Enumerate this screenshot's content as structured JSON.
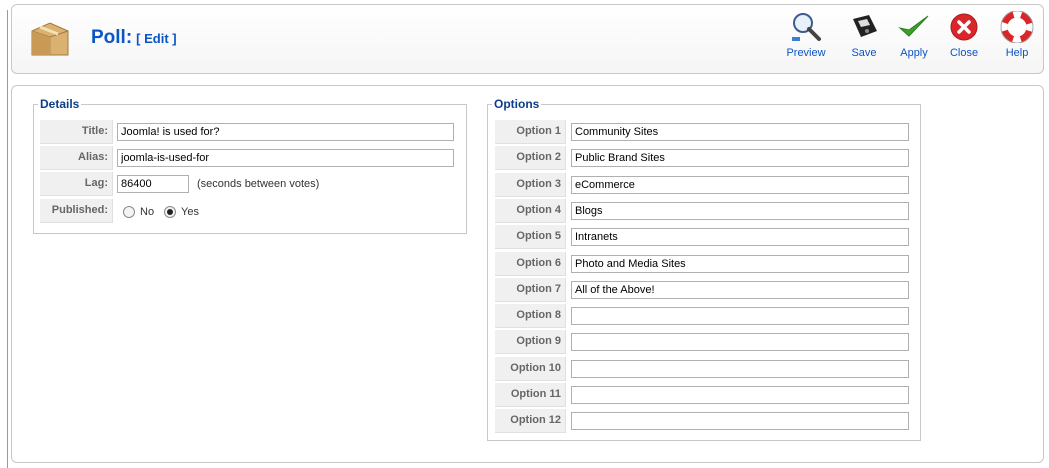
{
  "header": {
    "title": "Poll:",
    "subtitle": "[ Edit ]",
    "icon": "poll-box-icon"
  },
  "toolbar": {
    "buttons": [
      {
        "label": "Preview",
        "icon": "magnifier-icon"
      },
      {
        "label": "Save",
        "icon": "floppy-disk-icon"
      },
      {
        "label": "Apply",
        "icon": "checkmark-icon"
      },
      {
        "label": "Close",
        "icon": "close-icon"
      },
      {
        "label": "Help",
        "icon": "lifebuoy-icon"
      }
    ]
  },
  "details": {
    "legend": "Details",
    "title_label": "Title:",
    "title_value": "Joomla! is used for?",
    "alias_label": "Alias:",
    "alias_value": "joomla-is-used-for",
    "lag_label": "Lag:",
    "lag_value": "86400",
    "lag_note": "(seconds between votes)",
    "published_label": "Published:",
    "published_no": "No",
    "published_yes": "Yes",
    "published_selected": "Yes"
  },
  "options": {
    "legend": "Options",
    "items": [
      {
        "label": "Option 1",
        "value": "Community Sites"
      },
      {
        "label": "Option 2",
        "value": "Public Brand Sites"
      },
      {
        "label": "Option 3",
        "value": "eCommerce"
      },
      {
        "label": "Option 4",
        "value": "Blogs"
      },
      {
        "label": "Option 5",
        "value": "Intranets"
      },
      {
        "label": "Option 6",
        "value": "Photo and Media Sites"
      },
      {
        "label": "Option 7",
        "value": "All of the Above!"
      },
      {
        "label": "Option 8",
        "value": ""
      },
      {
        "label": "Option 9",
        "value": ""
      },
      {
        "label": "Option 10",
        "value": ""
      },
      {
        "label": "Option 11",
        "value": ""
      },
      {
        "label": "Option 12",
        "value": ""
      }
    ]
  },
  "colors": {
    "title_blue": "#0b55c4",
    "legend_blue": "#0b3e8a",
    "apply_green": "#3ca12a",
    "close_red": "#d8262a"
  }
}
